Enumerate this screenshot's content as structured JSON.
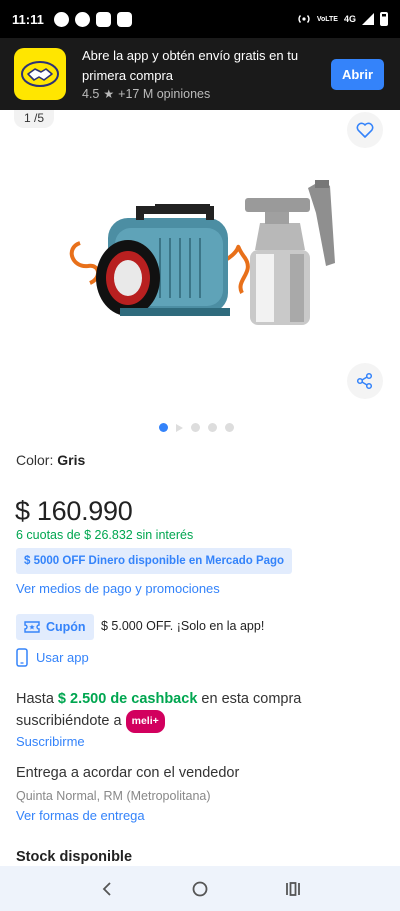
{
  "status_bar": {
    "time": "11:11",
    "network_small": "VoLTE",
    "network": "4G"
  },
  "app_banner": {
    "title": "Abre la app y obtén envío gratis en tu primera compra",
    "rating": "4.5",
    "reviews": "+17 M opiniones",
    "open_label": "Abrir",
    "brand_color": "#ffe600"
  },
  "gallery": {
    "counter": "1 /5",
    "pages": 5,
    "active_page": 1
  },
  "product": {
    "color_label": "Color: ",
    "color_value": "Gris",
    "price": "$ 160.990",
    "installments": "6 cuotas de $ 26.832 sin interés",
    "promo": "$ 5000 OFF Dinero disponible en Mercado Pago",
    "payment_link": "Ver medios de pago y promociones",
    "coupon_label": "Cupón",
    "coupon_text": "$ 5.000 OFF. ¡Solo en la app!",
    "use_app": "Usar app"
  },
  "cashback": {
    "prefix": "Hasta ",
    "amount": "$ 2.500 de cashback",
    "middle": " en esta compra suscribiéndote a ",
    "badge": "meli+",
    "link": "Suscribirme"
  },
  "delivery": {
    "title": "Entrega a acordar con el vendedor",
    "location": "Quinta Normal, RM (Metropolitana)",
    "link": "Ver formas de entrega"
  },
  "stock": "Stock disponible",
  "colors": {
    "accent": "#3483fa",
    "green": "#00a650",
    "meli_plus": "#d2005e"
  }
}
